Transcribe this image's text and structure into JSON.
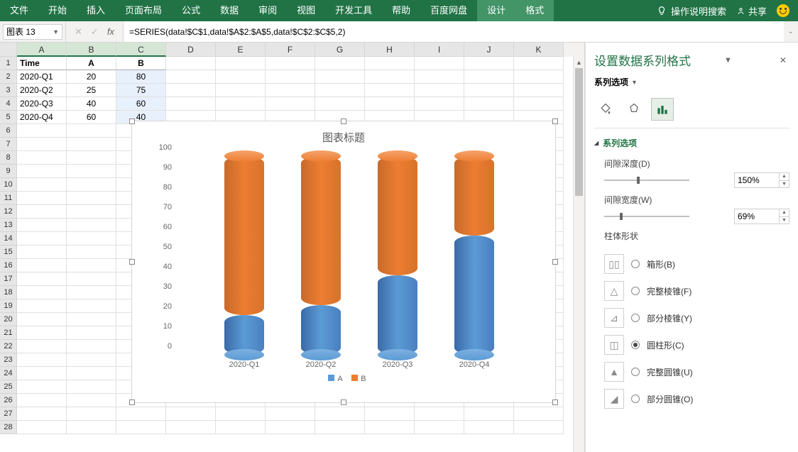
{
  "ribbon": {
    "tabs": [
      "文件",
      "开始",
      "插入",
      "页面布局",
      "公式",
      "数据",
      "审阅",
      "视图",
      "开发工具",
      "帮助",
      "百度网盘",
      "设计",
      "格式"
    ],
    "active_tabs": [
      "设计",
      "格式"
    ],
    "tell_me": "操作说明搜索",
    "share": "共享"
  },
  "namebox": "图表 13",
  "formula": "=SERIES(data!$C$1,data!$A$2:$A$5,data!$C$2:$C$5,2)",
  "columns": [
    "A",
    "B",
    "C",
    "D",
    "E",
    "F",
    "G",
    "H",
    "I",
    "J",
    "K"
  ],
  "row_count": 28,
  "grid": {
    "headers": [
      "Time",
      "A",
      "B"
    ],
    "rows": [
      [
        "2020-Q1",
        "20",
        "80"
      ],
      [
        "2020-Q2",
        "25",
        "75"
      ],
      [
        "2020-Q3",
        "40",
        "60"
      ],
      [
        "2020-Q4",
        "60",
        "40"
      ]
    ]
  },
  "chart_data": {
    "type": "bar",
    "title": "图表标题",
    "categories": [
      "2020-Q1",
      "2020-Q2",
      "2020-Q3",
      "2020-Q4"
    ],
    "series": [
      {
        "name": "A",
        "color": "#5b9bd5",
        "values": [
          20,
          25,
          40,
          60
        ]
      },
      {
        "name": "B",
        "color": "#ed7d31",
        "values": [
          80,
          75,
          60,
          40
        ]
      }
    ],
    "ylim": [
      0,
      100
    ],
    "yticks": [
      0,
      10,
      20,
      30,
      40,
      50,
      60,
      70,
      80,
      90,
      100
    ],
    "stacked": true,
    "shape": "cylinder"
  },
  "panel": {
    "title": "设置数据系列格式",
    "subtitle": "系列选项",
    "section": "系列选项",
    "gap_depth": {
      "label": "间隙深度(D)",
      "value": "150%",
      "slider_pos": 38
    },
    "gap_width": {
      "label": "间隙宽度(W)",
      "value": "69%",
      "slider_pos": 18
    },
    "shape_label": "柱体形状",
    "shapes": [
      {
        "label": "箱形(B)",
        "icon": "▯▯",
        "checked": false
      },
      {
        "label": "完整棱锥(F)",
        "icon": "△",
        "checked": false
      },
      {
        "label": "部分棱锥(Y)",
        "icon": "⊿",
        "checked": false
      },
      {
        "label": "圆柱形(C)",
        "icon": "◫",
        "checked": true
      },
      {
        "label": "完整圆锥(U)",
        "icon": "▲",
        "checked": false
      },
      {
        "label": "部分圆锥(O)",
        "icon": "◢",
        "checked": false
      }
    ]
  }
}
